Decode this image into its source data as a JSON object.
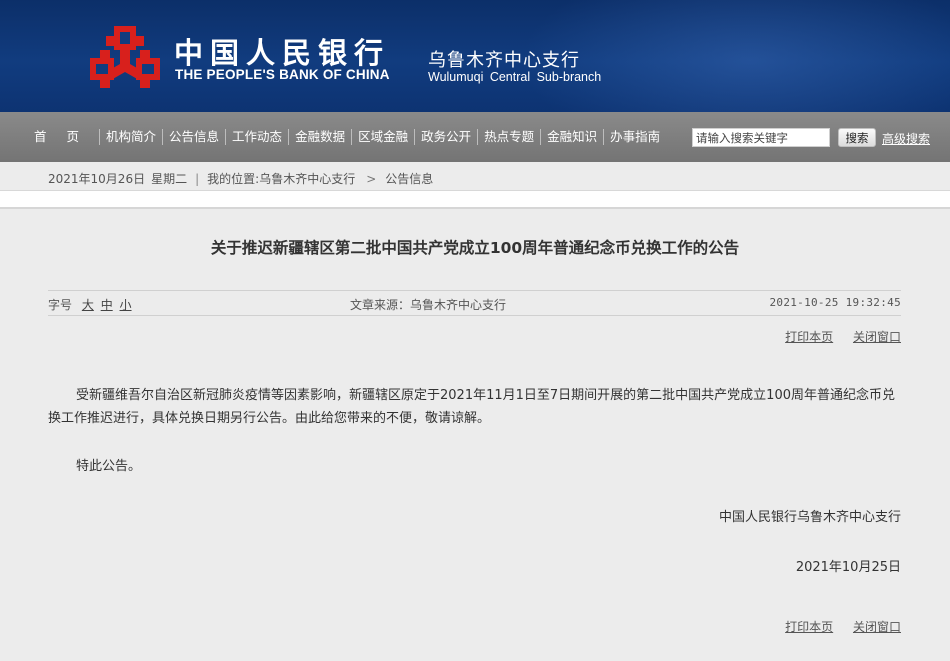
{
  "header": {
    "bank_name_cn": "中国人民银行",
    "bank_name_en": "THE PEOPLE'S BANK OF CHINA",
    "branch_cn": "乌鲁木齐中心支行",
    "branch_en": "Wulumuqi Central Sub-branch",
    "logo_icon": "pboc-emblem-icon",
    "colors": {
      "banner": "#113c7f",
      "logo_red": "#d8201c",
      "nav": "#7f7f7f"
    }
  },
  "nav": {
    "items": [
      "首页",
      "机构简介",
      "公告信息",
      "工作动态",
      "金融数据",
      "区域金融",
      "政务公开",
      "热点专题",
      "金融知识",
      "办事指南"
    ],
    "search_placeholder": "请输入搜索关键字",
    "search_button": "搜索",
    "advanced_search": "高级搜索"
  },
  "breadcrumb": {
    "date": "2021年10月26日",
    "weekday": "星期二",
    "separator": "|",
    "location_label": "我的位置:",
    "location_link": "乌鲁木齐中心支行",
    "chevron_icon": "chevron-right-icon",
    "current": "公告信息"
  },
  "article": {
    "title": "关于推迟新疆辖区第二批中国共产党成立100周年普通纪念币兑换工作的公告",
    "font_size_label": "字号",
    "font_size_options": [
      "大",
      "中",
      "小"
    ],
    "source": "文章来源：乌鲁木齐中心支行",
    "timestamp": "2021-10-25 19:32:45",
    "print_label": "打印本页",
    "close_label": "关闭窗口",
    "paragraphs": [
      "受新疆维吾尔自治区新冠肺炎疫情等因素影响，新疆辖区原定于2021年11月1日至7日期间开展的第二批中国共产党成立100周年普通纪念币兑换工作推迟进行，具体兑换日期另行公告。由此给您带来的不便，敬请谅解。",
      "特此公告。"
    ],
    "signature": "中国人民银行乌鲁木齐中心支行",
    "date": "2021年10月25日"
  }
}
